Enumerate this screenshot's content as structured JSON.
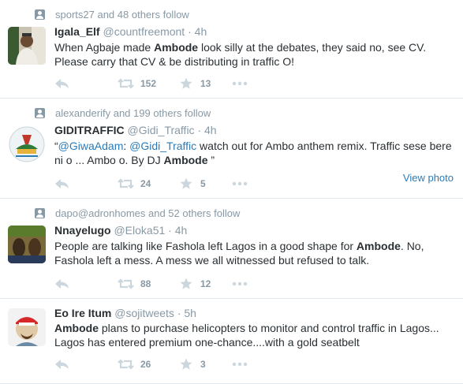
{
  "tweets": [
    {
      "context": "sports27 and 48 others follow",
      "name": "Igala_Elf",
      "handle": "@countfreemont",
      "dot": "·",
      "time": "4h",
      "text_parts": [
        "When Agbaje made ",
        "Ambode",
        " look silly at the debates, they said no, see CV. Please carry that CV & be distributing in traffic O!"
      ],
      "retweets": "152",
      "favorites": "13"
    },
    {
      "context": "alexanderify and 199 others follow",
      "name": "GIDITRAFFIC",
      "handle": "@Gidi_Traffic",
      "dot": "·",
      "time": "4h",
      "text_parts": [
        "“",
        "@GiwaAdam",
        ": ",
        "@Gidi_Traffic",
        " watch out for Ambo anthem remix. Traffic sese bere ni o ... Ambo o. By DJ ",
        "Ambode",
        " ”"
      ],
      "retweets": "24",
      "favorites": "5",
      "view_photo": "View photo"
    },
    {
      "context": "dapo@adronhomes and 52 others follow",
      "name": "Nnayelugo",
      "handle": "@Eloka51",
      "dot": "·",
      "time": "4h",
      "text_parts": [
        "People are talking like Fashola left Lagos in a good shape for ",
        "Ambode",
        ". No, Fashola left a mess. A mess we all witnessed but refused to talk."
      ],
      "retweets": "88",
      "favorites": "12"
    },
    {
      "name": "Eo Ire Itum",
      "handle": "@sojitweets",
      "dot": "·",
      "time": "5h",
      "text_parts": [
        "Ambode",
        " plans to purchase helicopters to monitor and control traffic in Lagos... Lagos has entered premium one-chance....with a gold seatbelt"
      ],
      "retweets": "26",
      "favorites": "3"
    }
  ],
  "colors": {
    "link": "#2b7bb9",
    "muted": "#8899a6",
    "divider": "#e1e8ed"
  },
  "icons": [
    "follow-icon",
    "reply-icon",
    "retweet-icon",
    "favorite-star-icon",
    "more-dots-icon"
  ]
}
